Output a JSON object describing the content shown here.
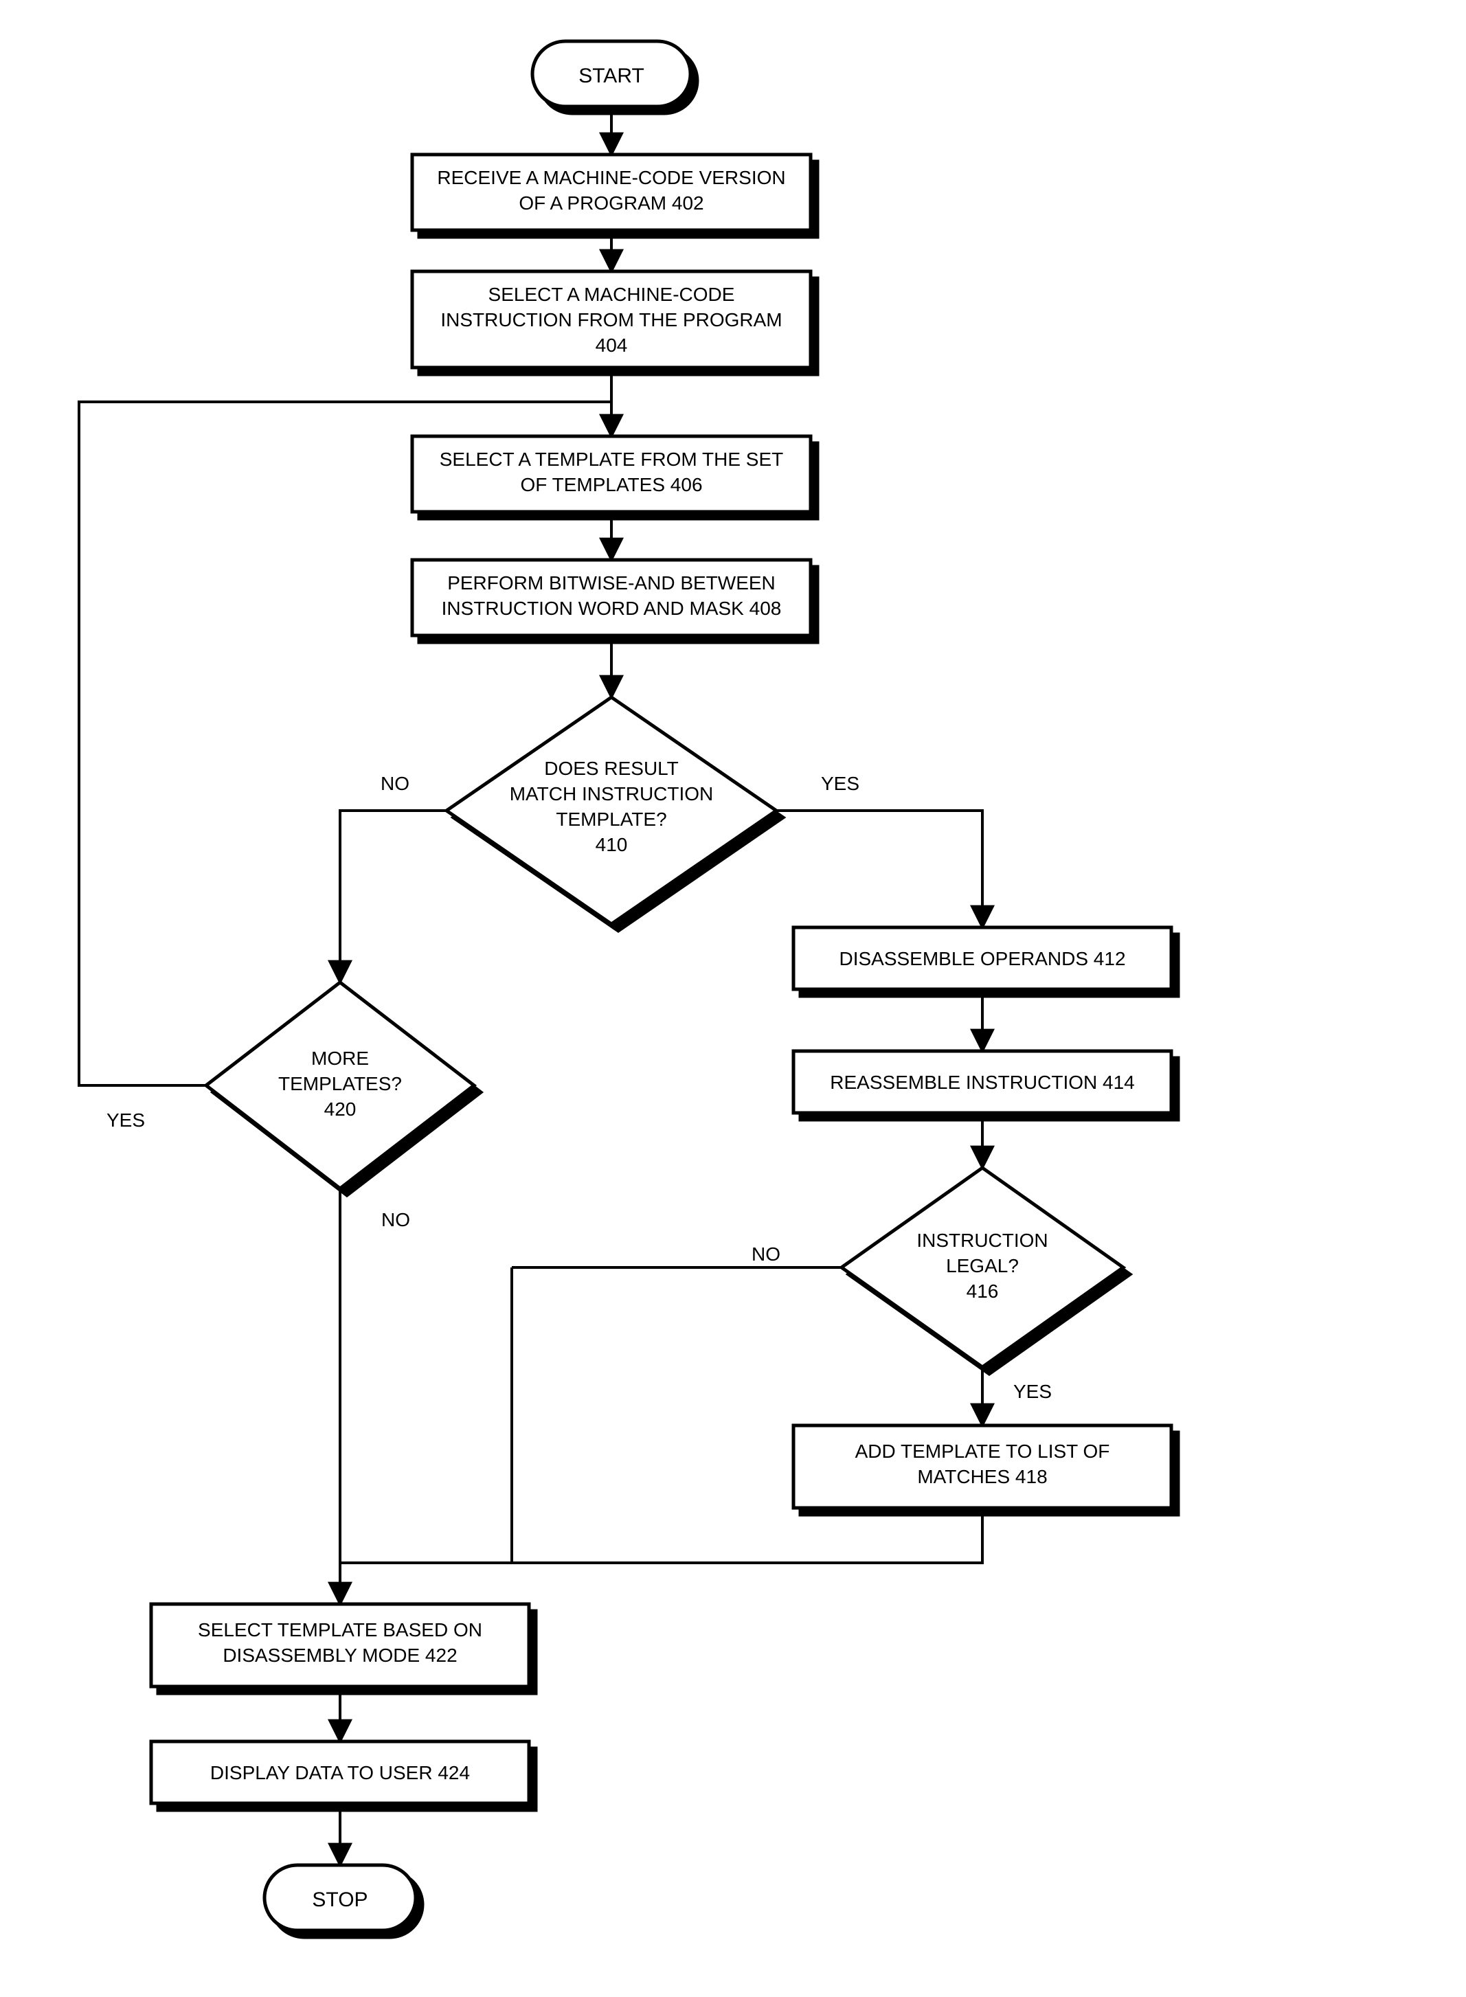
{
  "flowchart": {
    "terminators": {
      "start": "START",
      "stop": "STOP"
    },
    "steps": {
      "s402": {
        "l1": "RECEIVE A MACHINE-CODE VERSION",
        "l2": "OF A PROGRAM 402"
      },
      "s404": {
        "l1": "SELECT A MACHINE-CODE",
        "l2": "INSTRUCTION FROM THE PROGRAM",
        "l3": "404"
      },
      "s406": {
        "l1": "SELECT A TEMPLATE FROM THE SET",
        "l2": "OF TEMPLATES 406"
      },
      "s408": {
        "l1": "PERFORM BITWISE-AND BETWEEN",
        "l2": "INSTRUCTION WORD AND MASK 408"
      },
      "s412": {
        "l1": "DISASSEMBLE OPERANDS 412"
      },
      "s414": {
        "l1": "REASSEMBLE INSTRUCTION 414"
      },
      "s418": {
        "l1": "ADD TEMPLATE TO LIST OF",
        "l2": "MATCHES 418"
      },
      "s422": {
        "l1": "SELECT TEMPLATE BASED ON",
        "l2": "DISASSEMBLY MODE 422"
      },
      "s424": {
        "l1": "DISPLAY DATA TO USER 424"
      }
    },
    "decisions": {
      "d410": {
        "l1": "DOES RESULT",
        "l2": "MATCH INSTRUCTION",
        "l3": "TEMPLATE?",
        "l4": "410"
      },
      "d416": {
        "l1": "INSTRUCTION",
        "l2": "LEGAL?",
        "l3": "416"
      },
      "d420": {
        "l1": "MORE",
        "l2": "TEMPLATES?",
        "l3": "420"
      }
    },
    "edge_labels": {
      "no": "NO",
      "yes": "YES"
    }
  }
}
